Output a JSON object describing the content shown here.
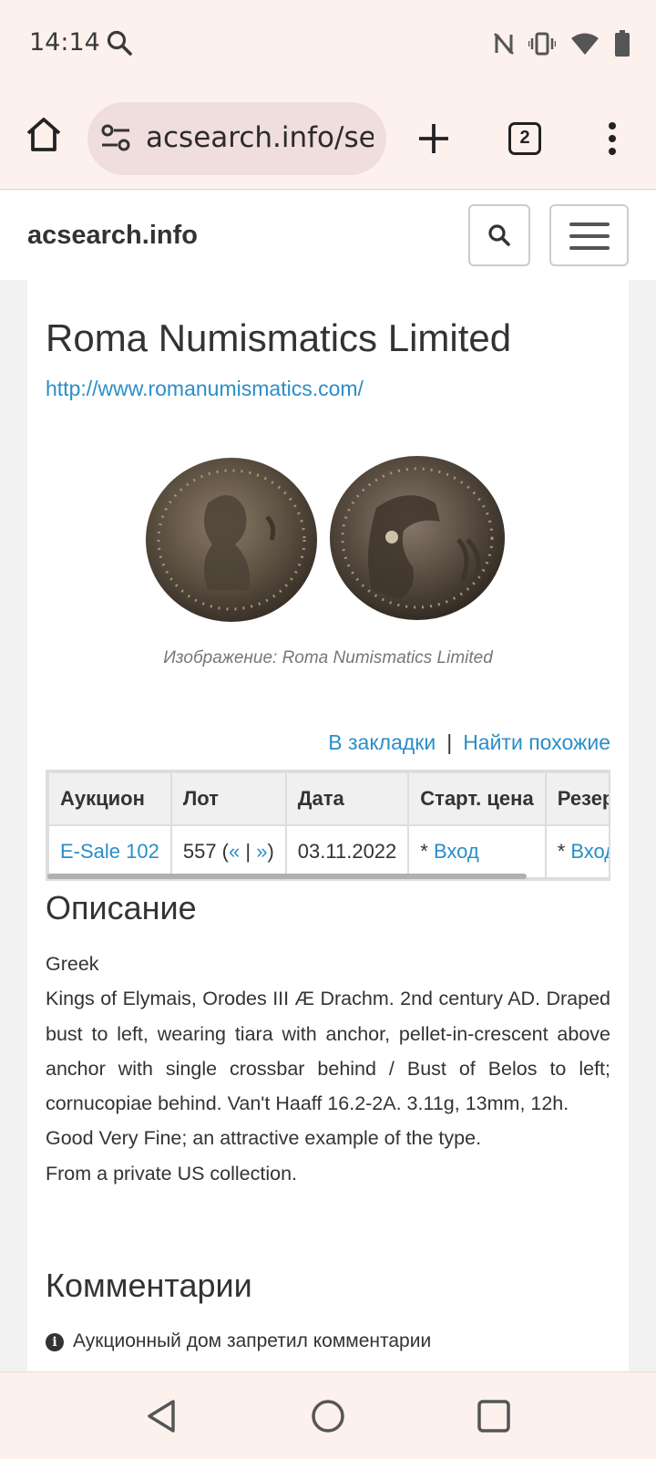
{
  "status_bar": {
    "time": "14:14",
    "icons": [
      "search-icon",
      "nfc-icon",
      "vibrate-icon",
      "wifi-icon",
      "battery-icon"
    ]
  },
  "browser": {
    "url": "acsearch.info/search",
    "tab_count": "2",
    "icons": [
      "home-icon",
      "tune-icon",
      "plus-icon",
      "tabs-icon",
      "more-vert-icon"
    ]
  },
  "site": {
    "brand": "acsearch.info"
  },
  "main": {
    "title": "Roma Numismatics Limited",
    "website": "http://www.romanumismatics.com/",
    "image_caption": "Изображение: Roma Numismatics Limited",
    "actions": {
      "bookmark": "В закладки",
      "separator": "|",
      "find_similar": "Найти похожие"
    },
    "table": {
      "headers": [
        "Аукцион",
        "Лот",
        "Дата",
        "Старт. цена",
        "Резерв"
      ],
      "row": {
        "auction": "E-Sale 102",
        "lot_number": "557 (",
        "lot_prev": "«",
        "lot_sep": " | ",
        "lot_next": "»",
        "lot_close": ")",
        "date": "03.11.2022",
        "start_prefix": "* ",
        "start_link": "Вход",
        "reserve_prefix": "* ",
        "reserve_link": "Вход"
      }
    },
    "description_heading": "Описание",
    "description": [
      "Greek",
      "Kings of Elymais, Orodes III Æ Drachm. 2nd century AD. Draped bust to left, wearing tiara with anchor, pellet-in-crescent above anchor with single crossbar behind / Bust of Belos to left; cornucopiae behind. Van't Haaff 16.2-2A. 3.11g, 13mm, 12h.",
      "Good Very Fine; an attractive example of the type.",
      "From a private US collection."
    ],
    "comments_heading": "Комментарии",
    "comments_notice": "Аукционный дом запретил комментарии"
  },
  "nav": {
    "icons": [
      "back-icon",
      "home-circle-icon",
      "recents-icon"
    ]
  }
}
